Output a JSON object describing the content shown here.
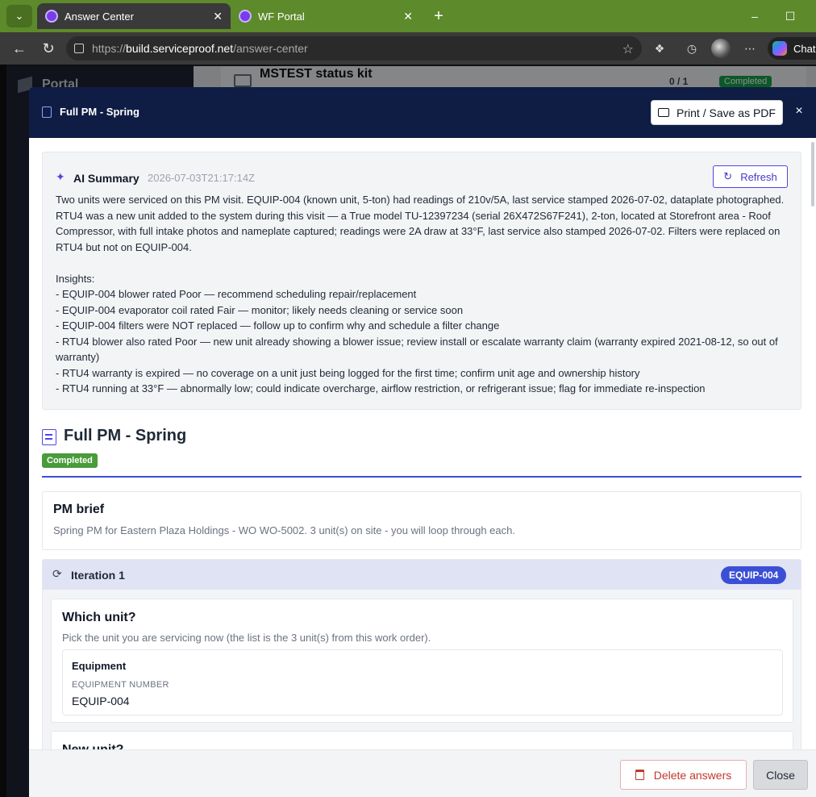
{
  "browser": {
    "tabs": [
      {
        "title": "Answer Center",
        "active": true
      },
      {
        "title": "WF Portal",
        "active": false
      }
    ],
    "url_scheme": "https://",
    "url_host": "build.serviceproof.net",
    "url_path": "/answer-center",
    "copilot_label": "Chat"
  },
  "background": {
    "portal_label": "Portal",
    "card_title": "MSTEST status kit",
    "count": "0 / 1",
    "status": "Completed"
  },
  "modal": {
    "title": "Full PM - Spring",
    "print_label": "Print / Save as PDF",
    "close_x": "×",
    "ai_summary": {
      "title": "AI Summary",
      "timestamp": "2026-07-03T21:17:14Z",
      "refresh_label": "Refresh",
      "paragraph": "Two units were serviced on this PM visit. EQUIP-004 (known unit, 5-ton) had readings of 210v/5A, last service stamped 2026-07-02, dataplate photographed. RTU4 was a new unit added to the system during this visit — a True model TU-12397234 (serial 26X472S67F241), 2-ton, located at Storefront area - Roof Compressor, with full intake photos and nameplate captured; readings were 2A draw at 33°F, last service also stamped 2026-07-02. Filters were replaced on RTU4 but not on EQUIP-004.",
      "insights_heading": "Insights:",
      "insights": [
        "- EQUIP-004 blower rated Poor — recommend scheduling repair/replacement",
        "- EQUIP-004 evaporator coil rated Fair — monitor; likely needs cleaning or service soon",
        "- EQUIP-004 filters were NOT replaced — follow up to confirm why and schedule a filter change",
        "- RTU4 blower also rated Poor — new unit already showing a blower issue; review install or escalate warranty claim (warranty expired 2021-08-12, so out of warranty)",
        "- RTU4 warranty is expired — no coverage on a unit just being logged for the first time; confirm unit age and ownership history",
        "- RTU4 running at 33°F — abnormally low; could indicate overcharge, airflow restriction, or refrigerant issue; flag for immediate re-inspection"
      ]
    },
    "form": {
      "title": "Full PM - Spring",
      "status": "Completed"
    },
    "brief": {
      "title": "PM brief",
      "text": "Spring PM for Eastern Plaza Holdings - WO WO-5002. 3 unit(s) on site - you will loop through each."
    },
    "iteration": {
      "title": "Iteration 1",
      "badge": "EQUIP-004",
      "question1": {
        "title": "Which unit?",
        "help": "Pick the unit you are servicing now (the list is the 3 unit(s) from this work order).",
        "answer_title": "Equipment",
        "answer_label": "EQUIPMENT NUMBER",
        "answer_value": "EQUIP-004"
      },
      "question2": {
        "title": "New unit?"
      }
    },
    "footer": {
      "delete_label": "Delete answers",
      "close_label": "Close"
    }
  },
  "colors": {
    "header_navy": "#0f1d45",
    "accent_indigo": "#3b4fd6",
    "completed_green": "#4a9b3a",
    "danger_red": "#c0392b",
    "tabbar_green": "#5d8a2a"
  }
}
